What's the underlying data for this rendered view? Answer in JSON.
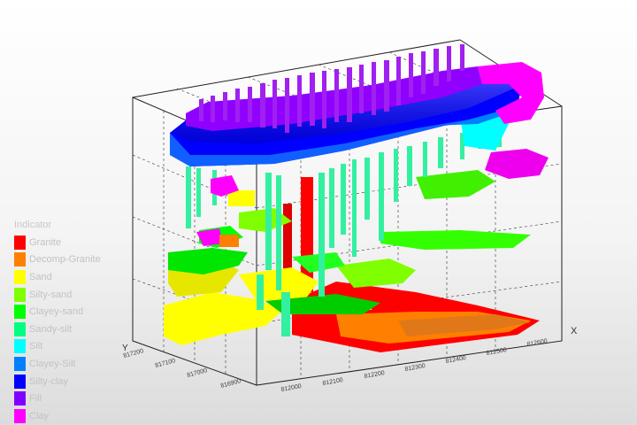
{
  "legend": {
    "title": "Indicator",
    "items": [
      {
        "label": "Granite",
        "color": "#ff0000"
      },
      {
        "label": "Decomp-Granite",
        "color": "#ff8000"
      },
      {
        "label": "Sand",
        "color": "#ffff00"
      },
      {
        "label": "Silty-sand",
        "color": "#80ff00"
      },
      {
        "label": "Clayey-sand",
        "color": "#00ff00"
      },
      {
        "label": "Sandy-silt",
        "color": "#00ff80"
      },
      {
        "label": "Silt",
        "color": "#00ffff"
      },
      {
        "label": "Clayey-Silt",
        "color": "#0080ff"
      },
      {
        "label": "Silty-clay",
        "color": "#0000ff"
      },
      {
        "label": "Fill",
        "color": "#8000ff"
      },
      {
        "label": "Clay",
        "color": "#ff00ff"
      }
    ]
  },
  "axes": {
    "x_label": "X",
    "y_label": "Y",
    "x_ticks": [
      "812000",
      "812100",
      "812200",
      "812300",
      "812400",
      "812500",
      "812600"
    ],
    "y_ticks": [
      "817200",
      "817100",
      "817000",
      "816900"
    ]
  }
}
